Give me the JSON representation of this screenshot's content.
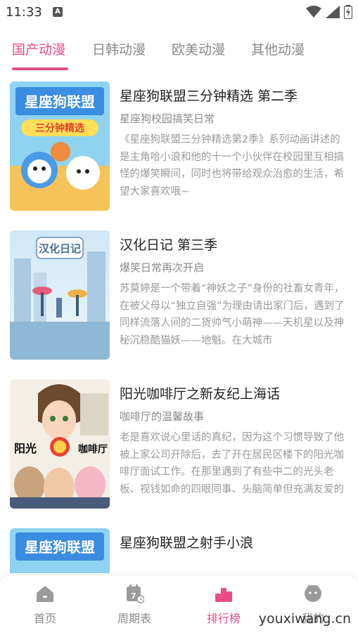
{
  "status_bar": {
    "time": "11:33",
    "notification_letter": "A"
  },
  "tabs": [
    {
      "label": "国产动漫",
      "active": true
    },
    {
      "label": "日韩动漫",
      "active": false
    },
    {
      "label": "欧美动漫",
      "active": false
    },
    {
      "label": "其他动漫",
      "active": false
    }
  ],
  "items": [
    {
      "title": "星座狗联盟三分钟精选 第二季",
      "subtitle": "星座狗校园搞笑日常",
      "description": "《星座狗联盟三分钟精选第2季》系列动画讲述的是主角哈小浪和他的十一个小伙伴在校园里互相搞怪的爆笑瞬间，同时也将带给观众治愈的生活，希望大家喜欢哦~",
      "cover_text": "星座狗联盟",
      "cover_subtext": "三分钟精选"
    },
    {
      "title": "汉化日记 第三季",
      "subtitle": "爆笑日常再次开启",
      "description": "苏莫婷是一个带着“神妖之子”身份的社畜女青年，在被父母以“独立自强”为理由请出家门后，遇到了同样流落人间的二货帅气小萌神——天机星以及神秘沉稳酷猫妖——地魁。在大城市",
      "cover_text": "汉化日记"
    },
    {
      "title": "阳光咖啡厅之新友纪上海话",
      "subtitle": "咖啡厅的温馨故事",
      "description": "老是喜欢说心里话的真纪，因为这个习惯导致了他被上家公司开除后，去了开在居民区楼下的阳光咖啡厅面试工作。在那里遇到了有些中二的光头老板、视钱如命的四眼同事、头脑简单但充满友爱的大块头同事，以",
      "cover_left": "阳光",
      "cover_right": "咖啡厅"
    },
    {
      "title": "星座狗联盟之射手小浪",
      "subtitle": "",
      "description": "",
      "cover_text": "星座狗联盟"
    }
  ],
  "bottom_nav": [
    {
      "label": "首页",
      "icon": "home-icon",
      "active": false
    },
    {
      "label": "周期表",
      "icon": "calendar-icon",
      "active": false
    },
    {
      "label": "排行榜",
      "icon": "ranking-icon",
      "active": true
    },
    {
      "label": "我的",
      "icon": "profile-icon",
      "active": false
    }
  ],
  "watermark": "youxiwang.cn",
  "colors": {
    "accent": "#e94b86",
    "inactive": "#8a8a8a"
  }
}
